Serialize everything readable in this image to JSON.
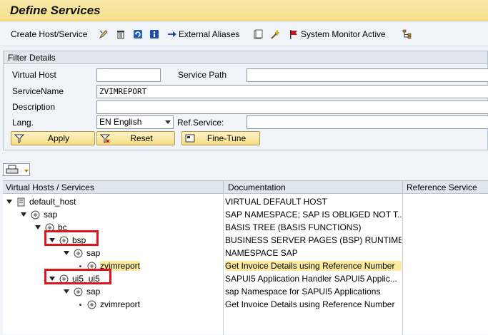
{
  "window": {
    "title": "Define Services"
  },
  "toolbar": {
    "create_label": "Create Host/Service",
    "external_aliases_label": "External Aliases",
    "system_monitor_label": "System Monitor Active"
  },
  "filter": {
    "header": "Filter Details",
    "virtual_host_label": "Virtual Host",
    "virtual_host_value": "",
    "service_path_label": "Service Path",
    "service_path_value": "",
    "service_name_label": "ServiceName",
    "service_name_value": "ZVIMREPORT",
    "description_label": "Description",
    "description_value": "",
    "lang_label": "Lang.",
    "lang_value": "EN English",
    "ref_service_label": "Ref.Service:",
    "ref_service_value": "",
    "apply_label": "Apply",
    "reset_label": "Reset",
    "finetune_label": "Fine-Tune"
  },
  "tree": {
    "col_services": "Virtual Hosts / Services",
    "col_documentation": "Documentation",
    "col_reference": "Reference Service",
    "rows": [
      {
        "name": "default_host",
        "doc": "VIRTUAL DEFAULT HOST",
        "icon": "host-icon"
      },
      {
        "name": "sap",
        "doc": "SAP NAMESPACE; SAP IS OBLIGED NOT T...",
        "icon": "service-node-icon"
      },
      {
        "name": "bc",
        "doc": "BASIS TREE (BASIS FUNCTIONS)",
        "icon": "service-node-icon"
      },
      {
        "name": "bsp",
        "doc": "BUSINESS SERVER PAGES (BSP) RUNTIME",
        "icon": "service-node-icon"
      },
      {
        "name": "sap",
        "doc": "NAMESPACE SAP",
        "icon": "service-node-icon"
      },
      {
        "name": "zvimreport",
        "doc": "Get Invoice Details using Reference Number",
        "icon": "service-node-icon"
      },
      {
        "name": "ui5_ui5",
        "doc": "SAPUI5 Application Handler SAPUI5 Applic...",
        "icon": "service-node-icon"
      },
      {
        "name": "sap",
        "doc": "sap Namespace for SAPUI5 Applications",
        "icon": "service-node-icon"
      },
      {
        "name": "zvimreport",
        "doc": "Get Invoice Details using Reference Number",
        "icon": "service-node-icon"
      }
    ]
  },
  "colors": {
    "title_bar": "#f6e08c",
    "button": "#f5dc86",
    "highlight_row": "#fbeaa0",
    "annotation_box": "#e1131b"
  }
}
